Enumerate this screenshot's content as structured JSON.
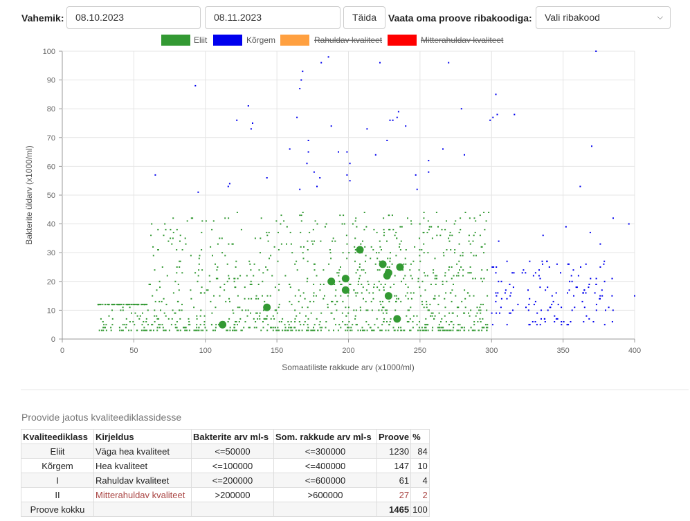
{
  "toolbar": {
    "period_label": "Vahemik:",
    "date_from": "08.10.2023",
    "date_to": "08.11.2023",
    "fill_button": "Täida",
    "barcode_label": "Vaata oma proove ribakoodiga:",
    "barcode_select": "Vali ribakood"
  },
  "chart_data": {
    "type": "scatter",
    "xlabel": "Somaatiliste rakkude arv (x1000/ml)",
    "ylabel": "Bakterite üldarv (x1000/ml)",
    "xlim": [
      0,
      400
    ],
    "ylim": [
      0,
      100
    ],
    "xticks": [
      0,
      50,
      100,
      150,
      200,
      250,
      300,
      350,
      400
    ],
    "yticks": [
      0,
      10,
      20,
      30,
      40,
      50,
      60,
      70,
      80,
      90,
      100
    ],
    "grid": true,
    "legend_position": "top",
    "series": [
      {
        "name": "Eliit",
        "color": "#339933",
        "hidden": false
      },
      {
        "name": "Kõrgem",
        "color": "#0000ee",
        "hidden": false
      },
      {
        "name": "Rahuldav kvaliteet",
        "color": "#ffa040",
        "hidden": true
      },
      {
        "name": "Mitterahuldav kvaliteet",
        "color": "#ff0000",
        "hidden": true
      }
    ],
    "highlighted_points": [
      {
        "x": 112,
        "y": 5
      },
      {
        "x": 143,
        "y": 11
      },
      {
        "x": 188,
        "y": 20
      },
      {
        "x": 198,
        "y": 21
      },
      {
        "x": 198,
        "y": 17
      },
      {
        "x": 208,
        "y": 31
      },
      {
        "x": 224,
        "y": 26
      },
      {
        "x": 228,
        "y": 23
      },
      {
        "x": 227,
        "y": 22
      },
      {
        "x": 236,
        "y": 25
      },
      {
        "x": 228,
        "y": 15
      },
      {
        "x": 234,
        "y": 7
      }
    ],
    "outlier_points": [
      {
        "x": 93,
        "y": 88
      },
      {
        "x": 65,
        "y": 57
      },
      {
        "x": 95,
        "y": 51
      },
      {
        "x": 130,
        "y": 81
      },
      {
        "x": 122,
        "y": 76
      },
      {
        "x": 133,
        "y": 75
      },
      {
        "x": 132,
        "y": 73
      },
      {
        "x": 117,
        "y": 54
      },
      {
        "x": 116,
        "y": 53
      },
      {
        "x": 143,
        "y": 56
      },
      {
        "x": 166,
        "y": 87
      },
      {
        "x": 167,
        "y": 90
      },
      {
        "x": 168,
        "y": 93
      },
      {
        "x": 181,
        "y": 96
      },
      {
        "x": 186,
        "y": 98
      },
      {
        "x": 188,
        "y": 74
      },
      {
        "x": 164,
        "y": 77
      },
      {
        "x": 172,
        "y": 69
      },
      {
        "x": 159,
        "y": 66
      },
      {
        "x": 172,
        "y": 65
      },
      {
        "x": 171,
        "y": 61
      },
      {
        "x": 176,
        "y": 58
      },
      {
        "x": 166,
        "y": 52
      },
      {
        "x": 178,
        "y": 53
      },
      {
        "x": 180,
        "y": 56
      },
      {
        "x": 199,
        "y": 65
      },
      {
        "x": 193,
        "y": 65
      },
      {
        "x": 201,
        "y": 61
      },
      {
        "x": 199,
        "y": 57
      },
      {
        "x": 201,
        "y": 55
      },
      {
        "x": 222,
        "y": 96
      },
      {
        "x": 227,
        "y": 69
      },
      {
        "x": 229,
        "y": 76
      },
      {
        "x": 231,
        "y": 76
      },
      {
        "x": 234,
        "y": 77
      },
      {
        "x": 235,
        "y": 79
      },
      {
        "x": 240,
        "y": 74
      },
      {
        "x": 213,
        "y": 73
      },
      {
        "x": 219,
        "y": 64
      },
      {
        "x": 247,
        "y": 57
      },
      {
        "x": 248,
        "y": 52
      },
      {
        "x": 256,
        "y": 62
      },
      {
        "x": 256,
        "y": 58
      },
      {
        "x": 266,
        "y": 66
      },
      {
        "x": 270,
        "y": 96
      },
      {
        "x": 279,
        "y": 80
      },
      {
        "x": 281,
        "y": 64
      },
      {
        "x": 299,
        "y": 76
      },
      {
        "x": 301,
        "y": 77
      },
      {
        "x": 303,
        "y": 85
      },
      {
        "x": 304,
        "y": 78
      },
      {
        "x": 316,
        "y": 78
      },
      {
        "x": 373,
        "y": 100
      },
      {
        "x": 370,
        "y": 67
      },
      {
        "x": 362,
        "y": 53
      },
      {
        "x": 385,
        "y": 42
      },
      {
        "x": 396,
        "y": 40
      },
      {
        "x": 369,
        "y": 37
      },
      {
        "x": 376,
        "y": 33
      },
      {
        "x": 352,
        "y": 39
      },
      {
        "x": 336,
        "y": 36
      },
      {
        "x": 305,
        "y": 34
      },
      {
        "x": 400,
        "y": 15
      }
    ]
  },
  "table": {
    "caption": "Proovide jaotus kvaliteediklassidesse",
    "headers": [
      "Kvaliteediklass",
      "Kirjeldus",
      "Bakterite arv ml-s",
      "Som. rakkude arv ml-s",
      "Proove",
      "%"
    ],
    "rows": [
      {
        "klass": "Eliit",
        "kirjeldus": "Väga hea kvaliteet",
        "bakterid": "<=50000",
        "rakud": "<=300000",
        "proove": "1230",
        "pct": "84"
      },
      {
        "klass": "Kõrgem",
        "kirjeldus": "Hea kvaliteet",
        "bakterid": "<=100000",
        "rakud": "<=400000",
        "proove": "147",
        "pct": "10"
      },
      {
        "klass": "I",
        "kirjeldus": "Rahuldav kvaliteet",
        "bakterid": "<=200000",
        "rakud": "<=600000",
        "proove": "61",
        "pct": "4"
      },
      {
        "klass": "II",
        "kirjeldus": "Mitterahuldav kvaliteet",
        "bakterid": ">200000",
        "rakud": ">600000",
        "proove": "27",
        "pct": "2"
      }
    ],
    "total": {
      "label": "Proove kokku",
      "proove": "1465",
      "pct": "100"
    }
  }
}
